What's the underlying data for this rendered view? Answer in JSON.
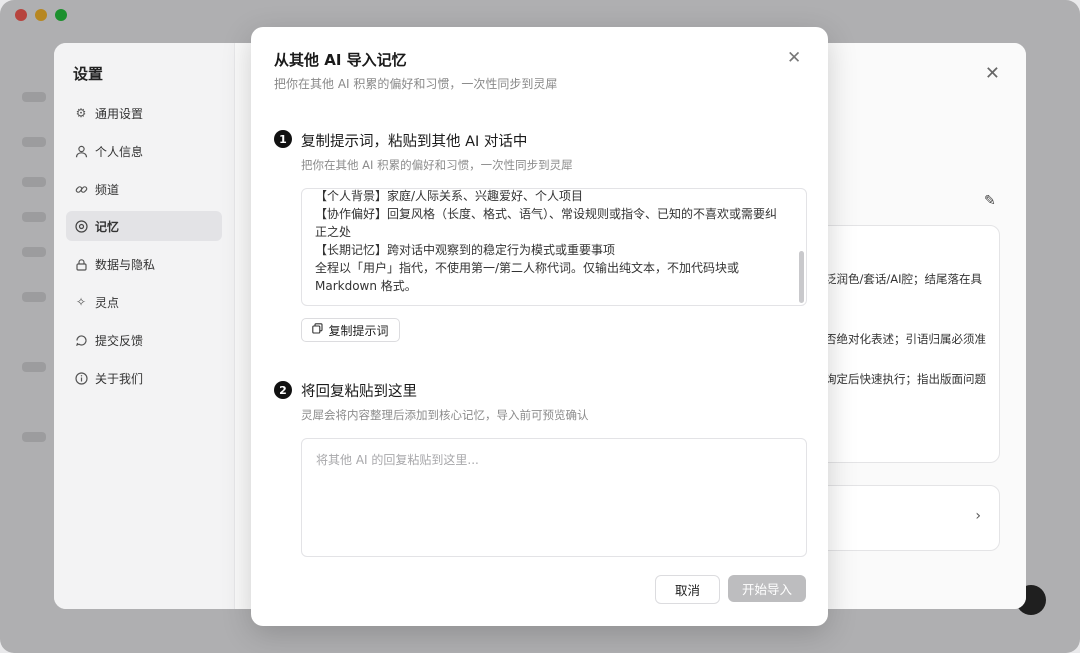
{
  "settings": {
    "title": "设置",
    "nav": [
      {
        "label": "通用设置",
        "icon": "gear-icon"
      },
      {
        "label": "个人信息",
        "icon": "user-icon"
      },
      {
        "label": "频道",
        "icon": "link-icon"
      },
      {
        "label": "记忆",
        "icon": "memory-icon",
        "active": true
      },
      {
        "label": "数据与隐私",
        "icon": "lock-icon"
      },
      {
        "label": "灵点",
        "icon": "sparkle-icon"
      },
      {
        "label": "提交反馈",
        "icon": "feedback-icon"
      },
      {
        "label": "关于我们",
        "icon": "info-icon"
      }
    ],
    "memory_card_fragments": [
      "泛润色/套话/AI腔；结尾落在具",
      "否绝对化表述；引语归属必须准",
      "询定后快速执行；指出版面问题"
    ]
  },
  "dialog": {
    "title": "从其他 AI 导入记忆",
    "subtitle": "把你在其他 AI 积累的偏好和习惯，一次性同步到灵犀",
    "step1": {
      "number": "1",
      "title": "复制提示词，粘贴到其他 AI 对话中",
      "desc": "把你在其他 AI 积累的偏好和习惯，一次性同步到灵犀",
      "prompt_lines": [
        "【个人背景】家庭/人际关系、兴趣爱好、个人项目",
        "【协作偏好】回复风格（长度、格式、语气）、常设规则或指令、已知的不喜欢或需要纠正之处",
        "【长期记忆】跨对话中观察到的稳定行为模式或重要事项",
        "全程以「用户」指代，不使用第一/第二人称代词。仅输出纯文本，不加代码块或 Markdown 格式。"
      ],
      "copy_label": "复制提示词"
    },
    "step2": {
      "number": "2",
      "title": "将回复粘贴到这里",
      "desc": "灵犀会将内容整理后添加到核心记忆，导入前可预览确认",
      "placeholder": "将其他 AI 的回复粘贴到这里...",
      "value": ""
    },
    "cancel_label": "取消",
    "start_label": "开始导入"
  },
  "colors": {
    "badge": "#111111",
    "start_disabled": "#bdbdbf",
    "close_red": "#fe5f57",
    "min_yellow": "#febc2e",
    "max_green": "#28c840"
  }
}
